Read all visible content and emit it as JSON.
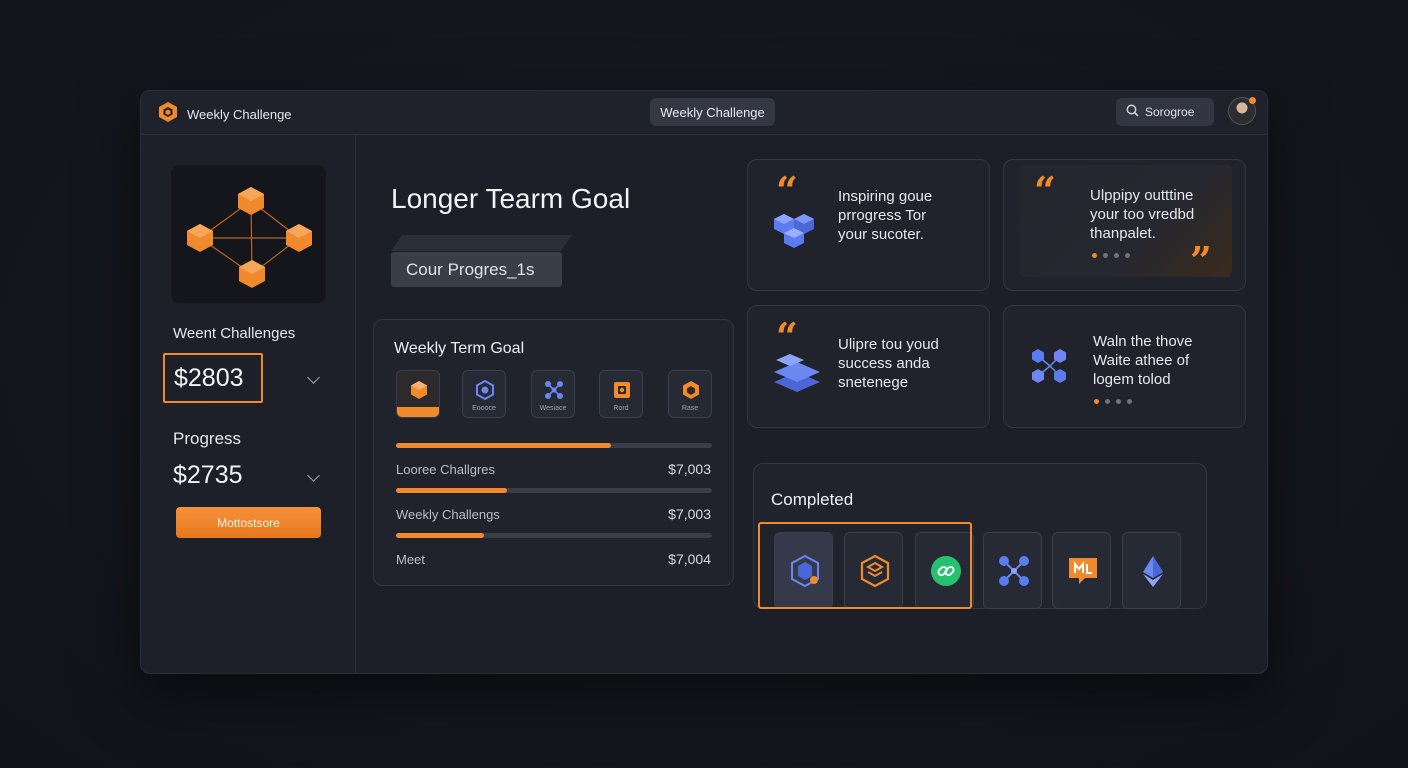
{
  "topbar": {
    "brand_title": "Weekly Challenge",
    "center_tab": "Weekly Challenge",
    "search_text": "Sorogroe"
  },
  "sidebar": {
    "section1_label": "Weent Challenges",
    "section1_amount": "$2803",
    "section2_label": "Progress",
    "section2_amount": "$2735",
    "button_label": "Mottostsore"
  },
  "main": {
    "title": "Longer Tearm Goal",
    "progress_pill": "Cour Progres_1s"
  },
  "goal_card": {
    "title": "Weekly Term Goal",
    "icons": [
      {
        "label": "",
        "icon": "cube-icon"
      },
      {
        "label": "Eoooce",
        "icon": "hexagon-icon"
      },
      {
        "label": "Wesiace",
        "icon": "network-icon"
      },
      {
        "label": "Rord",
        "icon": "box-icon"
      },
      {
        "label": "Rase",
        "icon": "gem-icon"
      }
    ],
    "rows": [
      {
        "progress": 0.68,
        "label": "Looree Challgres",
        "value": "$7,003"
      },
      {
        "progress": 0.35,
        "label": "Weekly Challengs",
        "value": "$7,003"
      },
      {
        "progress": 0.28,
        "label": "Meet",
        "value": "$7,004"
      }
    ]
  },
  "quotes": [
    {
      "text": [
        "Inspiring goue",
        "prrogress Tor",
        "your sucoter."
      ],
      "icon": "cube-cluster-icon"
    },
    {
      "text": [
        "Ulppipy outttine",
        "your too vredbd",
        "thanpalet."
      ],
      "dots_active": 0
    },
    {
      "text": [
        "Ulipre tou youd",
        "success anda",
        "snetenege"
      ],
      "icon": "layers-icon"
    },
    {
      "text": [
        "Waln the thove",
        "Waite athee of",
        "logem tolod"
      ],
      "icon": "hex-cluster-icon",
      "dots_active": 0
    }
  ],
  "completed": {
    "title": "Completed",
    "badges": [
      "shield-badge-icon",
      "hexagon-badge-icon",
      "link-badge-icon",
      "network-badge-icon",
      "chat-badge-icon",
      "ethereum-badge-icon"
    ]
  },
  "colors": {
    "accent": "#f08a2c",
    "secondary": "#5b7cf0",
    "panel": "#20232c",
    "background": "#14171e"
  }
}
